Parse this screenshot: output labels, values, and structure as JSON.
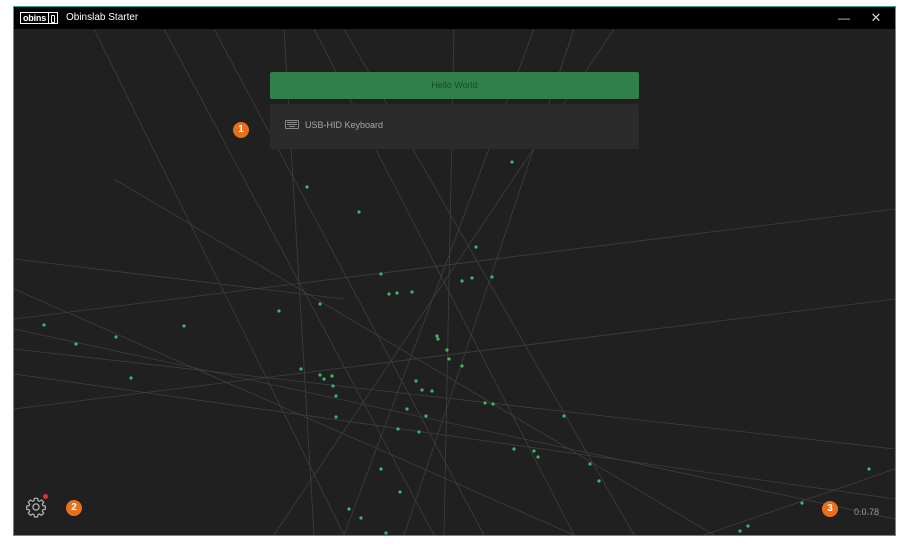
{
  "window": {
    "title": "Obinslab Starter",
    "logo_text": "obins",
    "minimize_glyph": "—",
    "close_glyph": "✕"
  },
  "main": {
    "primary_button_label": "Hello World",
    "device": {
      "name": "USB-HID Keyboard",
      "icon": "keyboard-icon"
    }
  },
  "annotations": [
    "1",
    "2",
    "3"
  ],
  "footer": {
    "settings_icon": "gear-icon",
    "version": "0.0.78"
  },
  "colors": {
    "accent_green": "#318049",
    "badge_orange": "#e8701d",
    "notification_red": "#e0303a",
    "window_border": "#2aa6a6",
    "background": "#202020"
  }
}
